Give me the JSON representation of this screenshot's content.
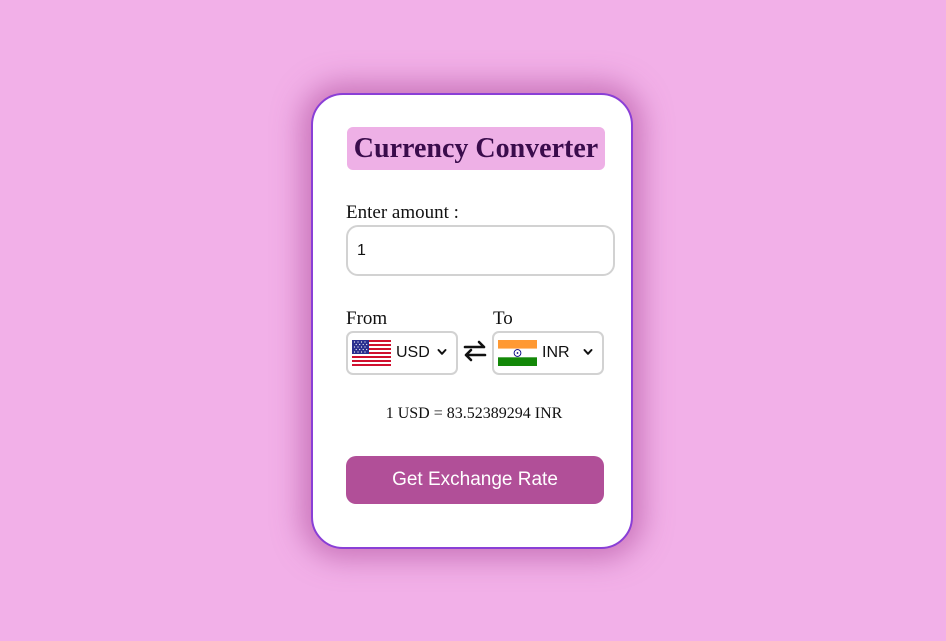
{
  "app": {
    "title": "Currency Converter"
  },
  "amount": {
    "label": "Enter amount :",
    "value": "1"
  },
  "from": {
    "label": "From",
    "currency": "USD",
    "flag_icon": "us-flag-icon"
  },
  "to": {
    "label": "To",
    "currency": "INR",
    "flag_icon": "india-flag-icon"
  },
  "swap_icon": "swap-arrows-icon",
  "result": {
    "text": "1 USD = 83.52389294 INR"
  },
  "button": {
    "label": "Get Exchange Rate"
  },
  "colors": {
    "background": "#f2b0e8",
    "card_border": "#8a3fd6",
    "title_bg": "#eeb0e6",
    "title_text": "#3a0c4c",
    "button_bg": "#b14f98"
  }
}
